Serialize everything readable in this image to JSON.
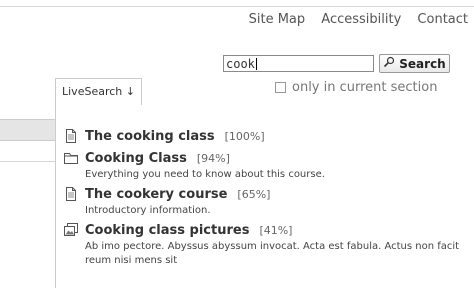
{
  "site_actions": [
    "Site Map",
    "Accessibility",
    "Contact"
  ],
  "search": {
    "value": "cook",
    "button_label": "Search",
    "only_current_label": "only in current section"
  },
  "livesearch": {
    "label": "LiveSearch ↓"
  },
  "results": [
    {
      "icon": "document-icon",
      "title": "The cooking class",
      "score": "[100%]",
      "description": ""
    },
    {
      "icon": "folder-icon",
      "title": "Cooking Class",
      "score": "[94%]",
      "description": "Everything you need to know about this course."
    },
    {
      "icon": "document-icon",
      "title": "The cookery course",
      "score": "[65%]",
      "description": "Introductory information."
    },
    {
      "icon": "image-gallery-icon",
      "title": "Cooking class pictures",
      "score": "[41%]",
      "description": "Ab imo pectore. Abyssus abyssum invocat. Acta est fabula. Actus non facit reum nisi mens sit"
    }
  ]
}
